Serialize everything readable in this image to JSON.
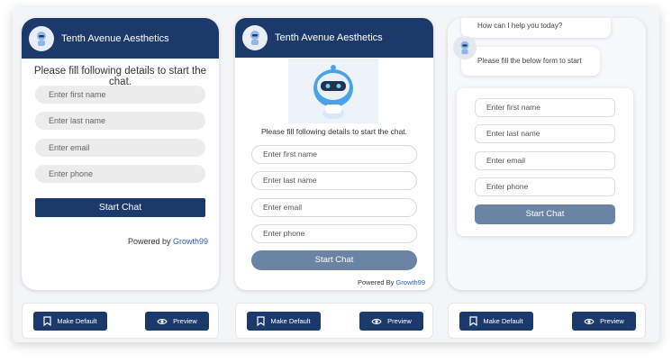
{
  "brand": {
    "primary": "#1b3a6b",
    "muted": "#6a84a6",
    "link": "#2b5fb4"
  },
  "card1": {
    "title": "Tenth Avenue Aesthetics",
    "intro": "Please fill following details to start the chat.",
    "first_name_placeholder": "Enter first name",
    "last_name_placeholder": "Enter last name",
    "email_placeholder": "Enter email",
    "phone_placeholder": "Enter phone",
    "start_label": "Start Chat",
    "powered_prefix": "Powered by ",
    "powered_brand": "Growth99"
  },
  "card2": {
    "title": "Tenth Avenue Aesthetics",
    "intro": "Please fill following details to start the chat.",
    "first_name_placeholder": "Enter first name",
    "last_name_placeholder": "Enter last name",
    "email_placeholder": "Enter email",
    "phone_placeholder": "Enter phone",
    "start_label": "Start Chat",
    "powered_prefix": "Powered By ",
    "powered_brand": "Growth99"
  },
  "card3": {
    "greeting": "How can I help you today?",
    "form_prompt": "Please fill the below form to start",
    "first_name_placeholder": "Enter first name",
    "last_name_placeholder": "Enter last name",
    "email_placeholder": "Enter email",
    "phone_placeholder": "Enter phone",
    "start_label": "Start Chat"
  },
  "actions": {
    "make_default_label": "Make Default",
    "preview_label": "Preview",
    "icons": [
      "bookmark-icon",
      "eye-icon"
    ]
  }
}
